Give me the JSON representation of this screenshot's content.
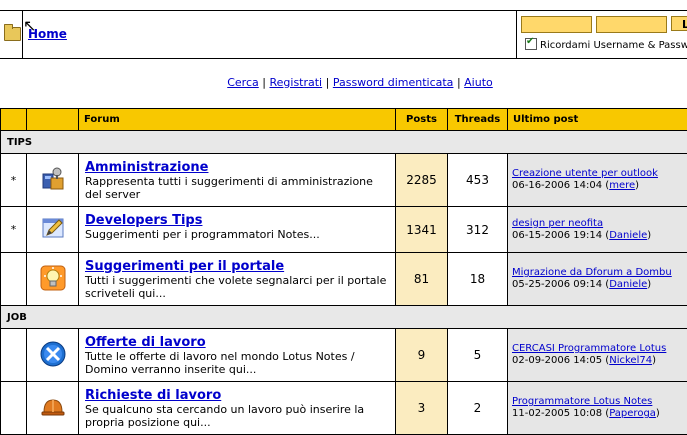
{
  "header": {
    "home_label": "Home",
    "remember_label": "Ricordami Username & Password",
    "login_button_label": "L"
  },
  "nav": {
    "links": [
      "Cerca",
      "Registrati",
      "Password dimenticata",
      "Aiuto"
    ],
    "separator": "|"
  },
  "table": {
    "columns": {
      "forum": "Forum",
      "posts": "Posts",
      "threads": "Threads",
      "last_post": "Ultimo post"
    },
    "categories": [
      {
        "name": "TIPS",
        "forums": [
          {
            "mark": "*",
            "icon": "admin-tools-icon",
            "title": "Amministrazione",
            "description": "Rappresenta tutti i suggerimenti di amministrazione del server",
            "posts": "2285",
            "threads": "453",
            "last_title": "Creazione utente per outlook",
            "last_date": "06-16-2006 14:04",
            "last_user": "mere"
          },
          {
            "mark": "*",
            "icon": "developer-pencil-icon",
            "title": "Developers Tips",
            "description": "Suggerimenti per i programmatori Notes...",
            "posts": "1341",
            "threads": "312",
            "last_title": "design per neofita",
            "last_date": "06-15-2006 19:14",
            "last_user": "Daniele"
          },
          {
            "mark": "",
            "icon": "lightbulb-icon",
            "title": "Suggerimenti per il portale",
            "description": "Tutti i suggerimenti che volete segnalarci per il portale scriveteli qui...",
            "posts": "81",
            "threads": "18",
            "last_title": "Migrazione da Dforum a Dombu",
            "last_date": "05-25-2006 09:14",
            "last_user": "Daniele"
          }
        ]
      },
      {
        "name": "JOB",
        "forums": [
          {
            "mark": "",
            "icon": "wrench-cross-icon",
            "title": "Offerte di lavoro",
            "description": "Tutte le offerte di lavoro nel mondo Lotus Notes / Domino verranno inserite qui...",
            "posts": "9",
            "threads": "5",
            "last_title": "CERCASI Programmatore Lotus",
            "last_date": "02-09-2006 14:05",
            "last_user": "Nickel74"
          },
          {
            "mark": "",
            "icon": "hard-hat-icon",
            "title": "Richieste di lavoro",
            "description": "Se qualcuno sta cercando un lavoro può inserire la propria posizione qui...",
            "posts": "3",
            "threads": "2",
            "last_title": "Programmatore Lotus Notes",
            "last_date": "11-02-2005 10:08",
            "last_user": "Paperoga"
          }
        ]
      }
    ]
  }
}
